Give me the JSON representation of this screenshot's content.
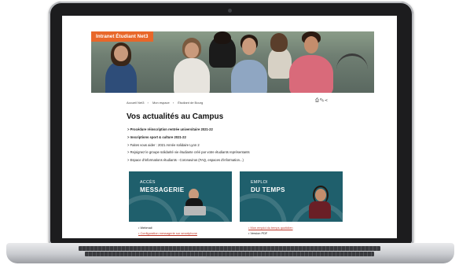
{
  "hero": {
    "tag": "Intranet Étudiant Net3"
  },
  "breadcrumb": [
    "Accueil Net3",
    "Mon espace",
    "Étudiant de Bourg"
  ],
  "tools": {
    "print_icon": "printer-icon",
    "edit_icon": "pencil-icon",
    "share_icon": "share-icon"
  },
  "page": {
    "title": "Vos actualités au Campus",
    "news": [
      {
        "text": "> Procédure réinscription rentrée universitaire 2021-22",
        "style": "bold"
      },
      {
        "text": "> Inscriptions sport & culture 2021-22",
        "style": "bold"
      },
      {
        "text": "> Faites vous aider : 2021 Année solidaire Lyon 2",
        "style": "normal"
      },
      {
        "text": "> Rejoignez le groupe solidarité vie étudiante créé par votre étudiants représentants",
        "style": "normal"
      },
      {
        "text": "> Espace d'informations étudiants - Coronavirus (FAQ, espaces d'information...)",
        "style": "normal"
      }
    ]
  },
  "cards": [
    {
      "line1": "ACCÈS",
      "line2": "MESSAGERIE",
      "bg": "#1f5f6c",
      "links": [
        "Webmail",
        "Configuration messagerie sur smartphone"
      ]
    },
    {
      "line1": "EMPLOI",
      "line2": "DU TEMPS",
      "bg": "#1f5f6c",
      "links": [
        "Mon emploi du temps quotidien",
        "Version PDF"
      ]
    }
  ]
}
